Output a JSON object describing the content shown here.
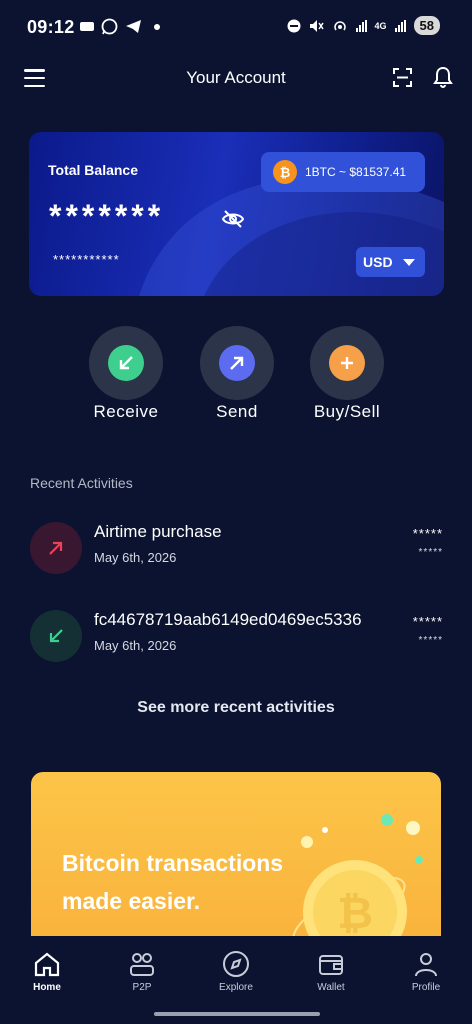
{
  "status_bar": {
    "time": "09:12",
    "network": "4G",
    "battery": "58"
  },
  "header": {
    "title": "Your Account",
    "menu_icon": "hamburger-menu-icon",
    "scan_icon": "scan-icon",
    "bell_icon": "notification-bell-icon"
  },
  "balance_card": {
    "label": "Total Balance",
    "balance_masked": "*******",
    "secondary_masked": "***********",
    "btc_rate": "1BTC ~ $81537.41",
    "btc_symbol": "₿",
    "currency": "USD",
    "colors": {
      "card": "#1a2eb8",
      "pill": "#3151d8"
    }
  },
  "actions": [
    {
      "label": "Receive",
      "icon": "arrow-down-left-icon",
      "color": "#3ecf8e"
    },
    {
      "label": "Send",
      "icon": "arrow-up-right-icon",
      "color": "#5b6cf0"
    },
    {
      "label": "Buy/Sell",
      "icon": "plus-icon",
      "color": "#f7a04a"
    }
  ],
  "recent": {
    "title": "Recent Activities",
    "items": [
      {
        "title": "Airtime purchase",
        "date": "May 6th, 2026",
        "amount": "*****",
        "sub_amount": "*****",
        "direction": "outgoing",
        "color": "#e8435a"
      },
      {
        "title": "fc44678719aab6149ed0469ec5336",
        "date": "May 6th, 2026",
        "amount": "*****",
        "sub_amount": "*****",
        "direction": "incoming",
        "color": "#3ecf8e"
      }
    ],
    "see_more": "See more recent activities"
  },
  "promo": {
    "text_line1": "Bitcoin transactions",
    "text_line2": "made easier.",
    "background": "#fbbd42"
  },
  "bottom_nav": [
    {
      "label": "Home",
      "icon": "home-icon",
      "active": true
    },
    {
      "label": "P2P",
      "icon": "users-icon",
      "active": false
    },
    {
      "label": "Explore",
      "icon": "compass-icon",
      "active": false
    },
    {
      "label": "Wallet",
      "icon": "wallet-icon",
      "active": false
    },
    {
      "label": "Profile",
      "icon": "profile-icon",
      "active": false
    }
  ]
}
